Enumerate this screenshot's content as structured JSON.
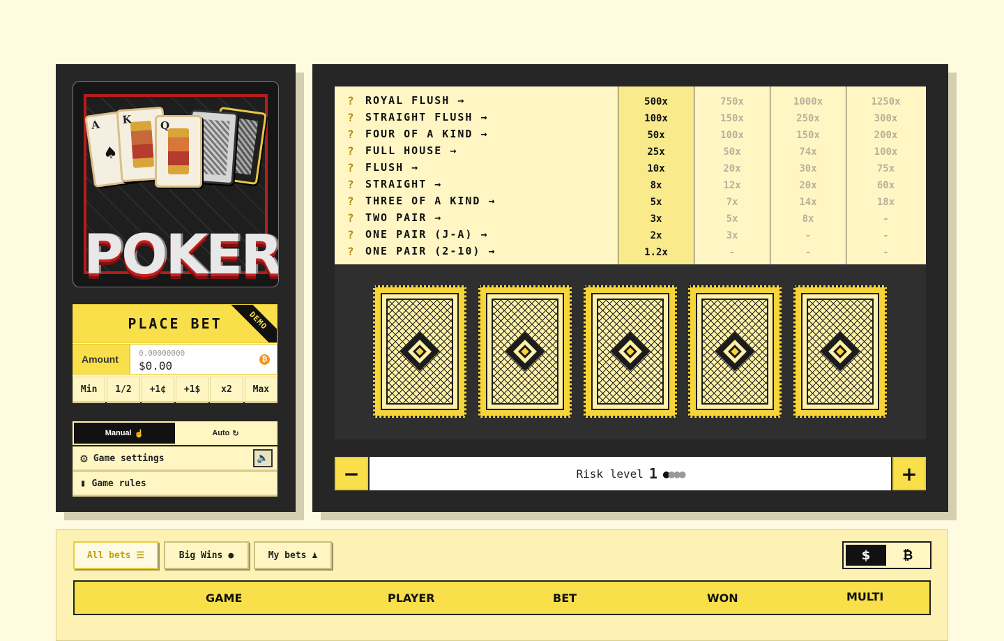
{
  "logo": {
    "title": "POKER",
    "cards": [
      "A",
      "K",
      "Q"
    ]
  },
  "bet": {
    "place_bet_label": "PLACE BET",
    "demo_badge": "DEMO",
    "amount_label": "Amount",
    "amount_btc": "0.00000000",
    "amount_usd": "$0.00",
    "coin_symbol": "₿",
    "quick_buttons": [
      "Min",
      "1/2",
      "+1¢",
      "+1$",
      "x2",
      "Max"
    ]
  },
  "mode": {
    "manual_label": "Manual",
    "auto_label": "Auto"
  },
  "settings": {
    "game_settings_label": "Game settings",
    "game_rules_label": "Game rules"
  },
  "paytable": {
    "hands": [
      "ROYAL FLUSH →",
      "STRAIGHT FLUSH →",
      "FOUR OF A KIND →",
      "FULL HOUSE →",
      "FLUSH →",
      "STRAIGHT →",
      "THREE OF A KIND →",
      "TWO PAIR →",
      "ONE PAIR (J-A) →",
      "ONE PAIR (2-10) →"
    ],
    "columns": [
      [
        "500x",
        "100x",
        "50x",
        "25x",
        "10x",
        "8x",
        "5x",
        "3x",
        "2x",
        "1.2x"
      ],
      [
        "750x",
        "150x",
        "100x",
        "50x",
        "20x",
        "12x",
        "7x",
        "5x",
        "3x",
        "-"
      ],
      [
        "1000x",
        "250x",
        "150x",
        "74x",
        "30x",
        "20x",
        "14x",
        "8x",
        "-",
        "-"
      ],
      [
        "1250x",
        "300x",
        "200x",
        "100x",
        "75x",
        "60x",
        "18x",
        "-",
        "-",
        "-"
      ]
    ],
    "active_column": 0
  },
  "risk": {
    "label": "Risk level",
    "level": "1",
    "minus": "−",
    "plus": "+",
    "max_level": 4
  },
  "bets_tabs": {
    "all_bets": "All bets",
    "big_wins": "Big Wins",
    "my_bets": "My bets"
  },
  "currency": {
    "usd_symbol": "$",
    "btc_symbol": "₿",
    "active": "usd"
  },
  "table_headers": {
    "game": "GAME",
    "player": "PLAYER",
    "bet": "BET",
    "won": "WON",
    "multi": "MULTI"
  },
  "colors": {
    "accent_yellow": "#f9df4a",
    "panel_dark": "#262626",
    "page_bg": "#fefbe0"
  }
}
